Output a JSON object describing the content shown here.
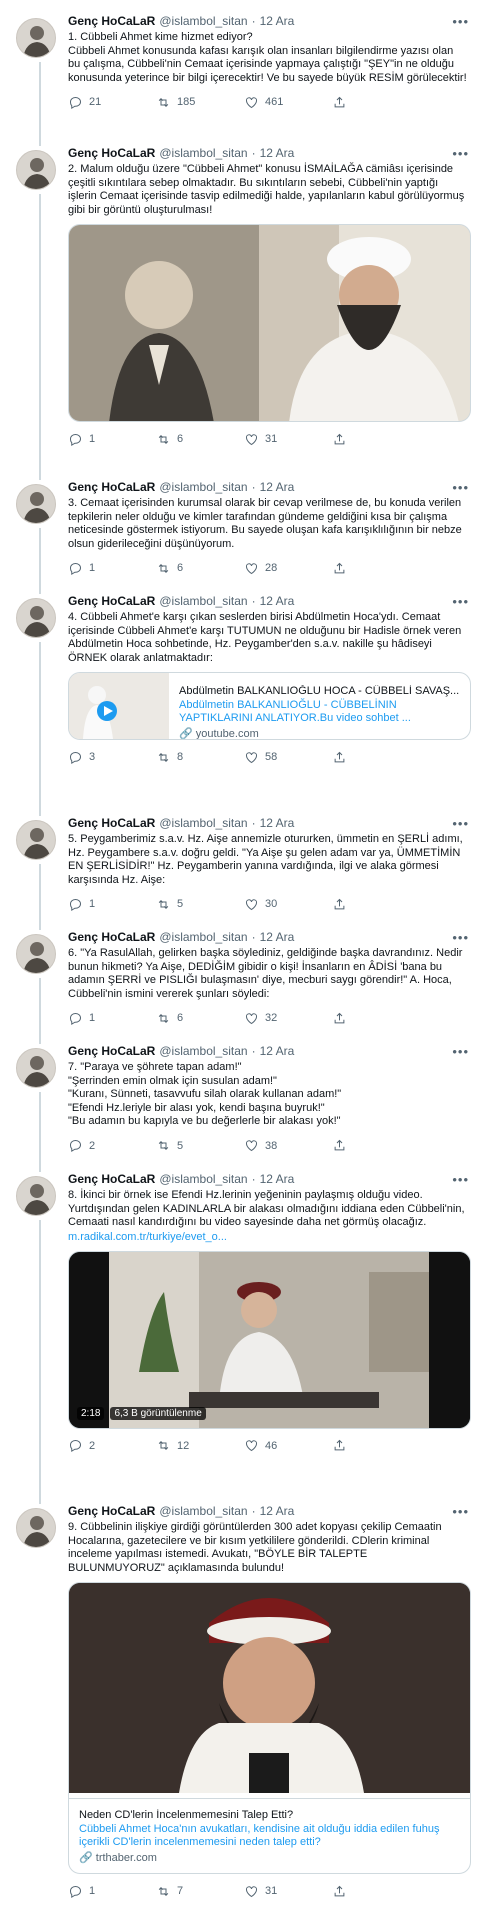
{
  "author": {
    "name": "Genç HoCaLaR",
    "handle": "@islambol_sitan",
    "dot": "·",
    "date": "12 Ara"
  },
  "more_label": "•••",
  "tweets": [
    {
      "text": "1. Cübbeli Ahmet kime hizmet ediyor?\nCübbeli Ahmet konusunda kafası karışık olan insanları bilgilendirme yazısı olan bu çalışma, Cübbeli'nin Cemaat içerisinde yapmaya çalıştığı \"ŞEY\"in ne olduğu konusunda yeterince bir bilgi içerecektir! Ve bu sayede büyük RESİM görülecektir!",
      "replies": "21",
      "retweets": "185",
      "likes": "461"
    },
    {
      "text": "2. Malum olduğu üzere \"Cübbeli Ahmet\" konusu İSMAİLAĞA cämiâsı içerisinde çeşitli sıkıntılara sebep olmaktadır. Bu sıkıntıların sebebi, Cübbeli'nin yaptığı işlerin Cemaat içerisinde tasvip edilmediği halde, yapılanların kabul görülüyormuş gibi bir görüntü oluşturulması!",
      "replies": "1",
      "retweets": "6",
      "likes": "31"
    },
    {
      "text": "3. Cemaat içerisinden kurumsal olarak bir cevap verilmese de, bu konuda verilen tepkilerin neler olduğu ve kimler tarafından gündeme geldiğini kısa bir çalışma neticesinde göstermek istiyorum. Bu sayede oluşan kafa karışıklılığının bir nebze olsun giderileceğini düşünüyorum.",
      "replies": "1",
      "retweets": "6",
      "likes": "28"
    },
    {
      "text": "4. Cübbeli Ahmet'e karşı çıkan seslerden birisi Abdülmetin Hoca'ydı. Cemaat içerisinde Cübbeli Ahmet'e karşı TUTUMUN ne olduğunu bir Hadisle örnek veren Abdülmetin Hoca sohbetinde, Hz. Peygamber'den s.a.v. nakille şu hâdiseyi ÖRNEK olarak anlatmaktadır:",
      "replies": "3",
      "retweets": "8",
      "likes": "58",
      "card": {
        "title": "Abdülmetin BALKANLIOĞLU HOCA - CÜBBELİ SAVAŞ...",
        "desc": "Abdülmetin BALKANLIOĞLU - CÜBBELİNIN YAPTIKLARINI ANLATIYOR.Bu video sohbet ...",
        "domain": "youtube.com"
      }
    },
    {
      "text": "5. Peygamberimiz s.a.v. Hz. Aişe annemizle otururken, ümmetin en ŞERLİ adımı, Hz. Peygambere s.a.v. doğru geldi. \"Ya Aişe şu gelen adam var ya, ÜMMETİMİN EN ŞERLİSİDİR!\" Hz. Peygamberin yanına vardığında, ilgi ve alaka görmesi karşısında Hz. Aişe:",
      "replies": "1",
      "retweets": "5",
      "likes": "30"
    },
    {
      "text": "6. \"Ya RasulAllah, gelirken başka söylediniz, geldiğinde başka davrandınız. Nedir bunun hikmeti? Ya Aişe, DEDİĞİM gibidir o kişi! İnsanların en ÂDİSİ 'bana bu adamın ŞERRİ ve PISLIĞI bulaşmasın' diye, mecburi saygı görendir!\" A. Hoca, Cübbeli'nin ismini vererek şunları söyledi:",
      "replies": "1",
      "retweets": "6",
      "likes": "32"
    },
    {
      "text": "7. \"Paraya ve şöhrete tapan adam!\"\n\"Şerrinden emin olmak için susulan adam!\"\n\"Kuranı, Sünneti, tasavvufu silah olarak kullanan adam!\"\n\"Efendi Hz.leriyle bir alası yok, kendi başına buyruk!\"\n\"Bu adamın bu kapıyla ve bu değerlerle bir alakası yok!\"",
      "replies": "2",
      "retweets": "5",
      "likes": "38"
    },
    {
      "text": "8. İkinci bir örnek ise Efendi Hz.lerinin yeğeninin paylaşmış olduğu video. Yurtdışından gelen KADINLARLA bir alakası olmadığını iddiana eden Cübbeli'nin, Cemaati nasıl kandırdığını bu video sayesinde daha net görmüş olacağız.",
      "link": "m.radikal.com.tr/turkiye/evet_o...",
      "replies": "2",
      "retweets": "12",
      "likes": "46",
      "video": {
        "duration": "2:18",
        "views": "6,3 B görüntülenme"
      }
    },
    {
      "text": "9. Cübbelinin ilişkiye girdiği görüntülerden 300 adet kopyası çekilip Cemaatin Hocalarına, gazetecilere ve bir kısım yetkililere gönderildi. CDlerin kriminal inceleme yapılması istemedi. Avukatı, \"BÖYLE BİR TALEPTE BULUNMUYORUZ\" açıklamasında bulundu!",
      "replies": "1",
      "retweets": "7",
      "likes": "31",
      "card": {
        "title": "Neden CD'lerin İncelenmemesini Talep Etti?",
        "desc": "Cübbeli Ahmet Hoca'nın avukatları, kendisine ait olduğu iddia edilen fuhuş içerikli CD'lerin incelenmemesini neden talep etti?",
        "domain": "trthaber.com"
      }
    }
  ]
}
